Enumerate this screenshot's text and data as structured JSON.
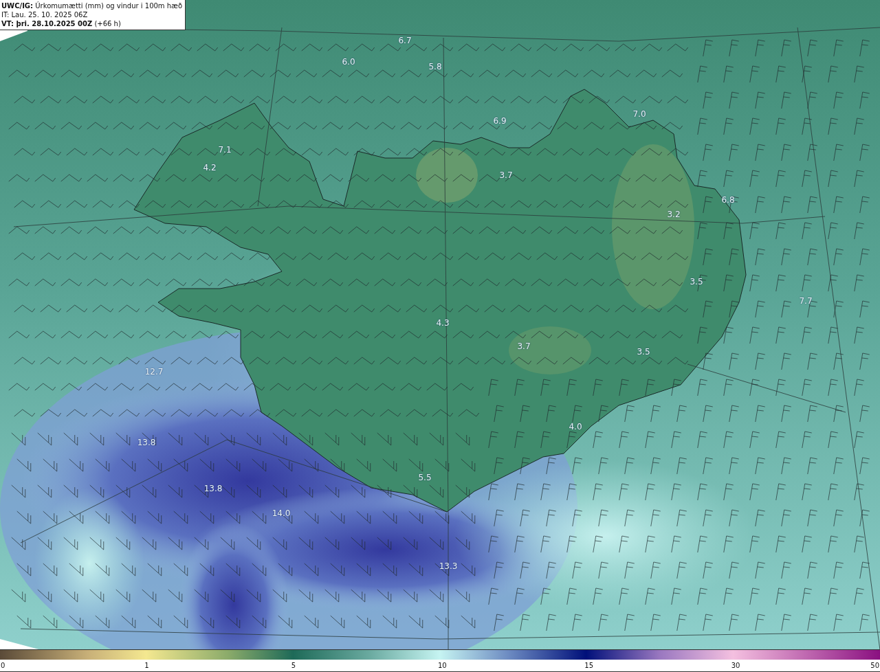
{
  "header": {
    "model": "UWC/IG:",
    "title": "Úrkomumætti (mm) og vindur i 100m hæð",
    "init_time": "IT: Lau. 25. 10. 2025 06Z",
    "valid_time": "VT: þri. 28.10.2025 00Z",
    "lead": "(+66 h)"
  },
  "map": {
    "value_labels": [
      {
        "text": "6.7"
      },
      {
        "text": "6.0"
      },
      {
        "text": "5.8"
      },
      {
        "text": "7.0"
      },
      {
        "text": "6.9"
      },
      {
        "text": "7.1"
      },
      {
        "text": "4.2"
      },
      {
        "text": "3.7"
      },
      {
        "text": "6.8"
      },
      {
        "text": "3.2"
      },
      {
        "text": "3.5"
      },
      {
        "text": "7.7"
      },
      {
        "text": "4.3"
      },
      {
        "text": "3.7"
      },
      {
        "text": "3.5"
      },
      {
        "text": "12.7"
      },
      {
        "text": "4.0"
      },
      {
        "text": "13.8"
      },
      {
        "text": "5.5"
      },
      {
        "text": "13.8"
      },
      {
        "text": "14.0"
      },
      {
        "text": "13.3"
      }
    ]
  },
  "colorbar": {
    "ticks": [
      "0",
      "1",
      "5",
      "10",
      "15",
      "30",
      "50"
    ]
  }
}
